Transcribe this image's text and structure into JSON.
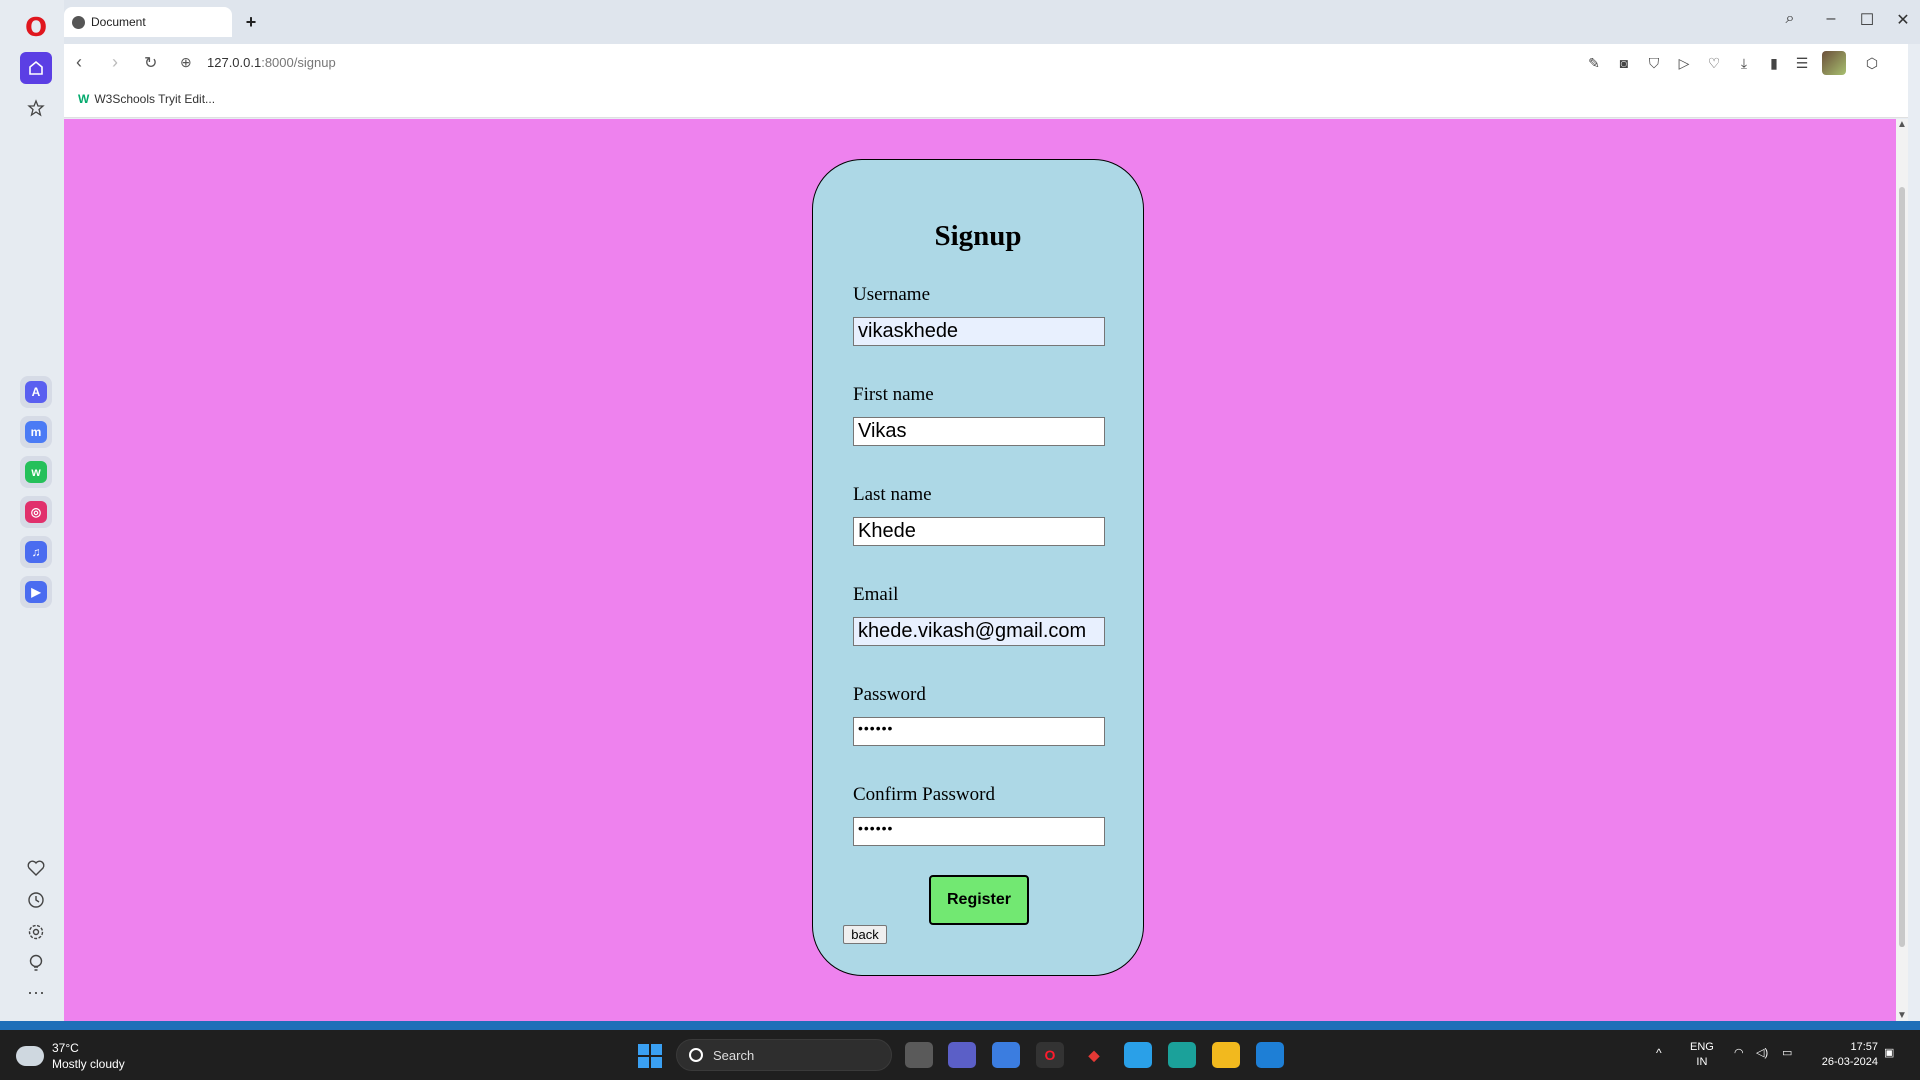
{
  "browser": {
    "tab_title": "Document",
    "new_tab_symbol": "+",
    "url_host": "127.0.0.1",
    "url_path": ":8000/signup",
    "bookmark_label": "W3Schools Tryit Edit...",
    "bookmark_badge": "W"
  },
  "page": {
    "background_color": "#ee82ee",
    "card_color": "#add8e6",
    "title": "Signup",
    "fields": [
      {
        "label": "Username",
        "value": "vikaskhede"
      },
      {
        "label": "First name",
        "value": "Vikas"
      },
      {
        "label": "Last name",
        "value": "Khede"
      },
      {
        "label": "Email",
        "value": "khede.vikash@gmail.com"
      },
      {
        "label": "Password",
        "value": "••••••"
      },
      {
        "label": "Confirm Password",
        "value": "••••••"
      }
    ],
    "register_label": "Register",
    "back_label": "back"
  },
  "taskbar": {
    "temperature": "37°C",
    "weather": "Mostly cloudy",
    "search_label": "Search",
    "lang_line1": "ENG",
    "lang_line2": "IN",
    "time": "17:57",
    "date": "26-03-2024"
  }
}
